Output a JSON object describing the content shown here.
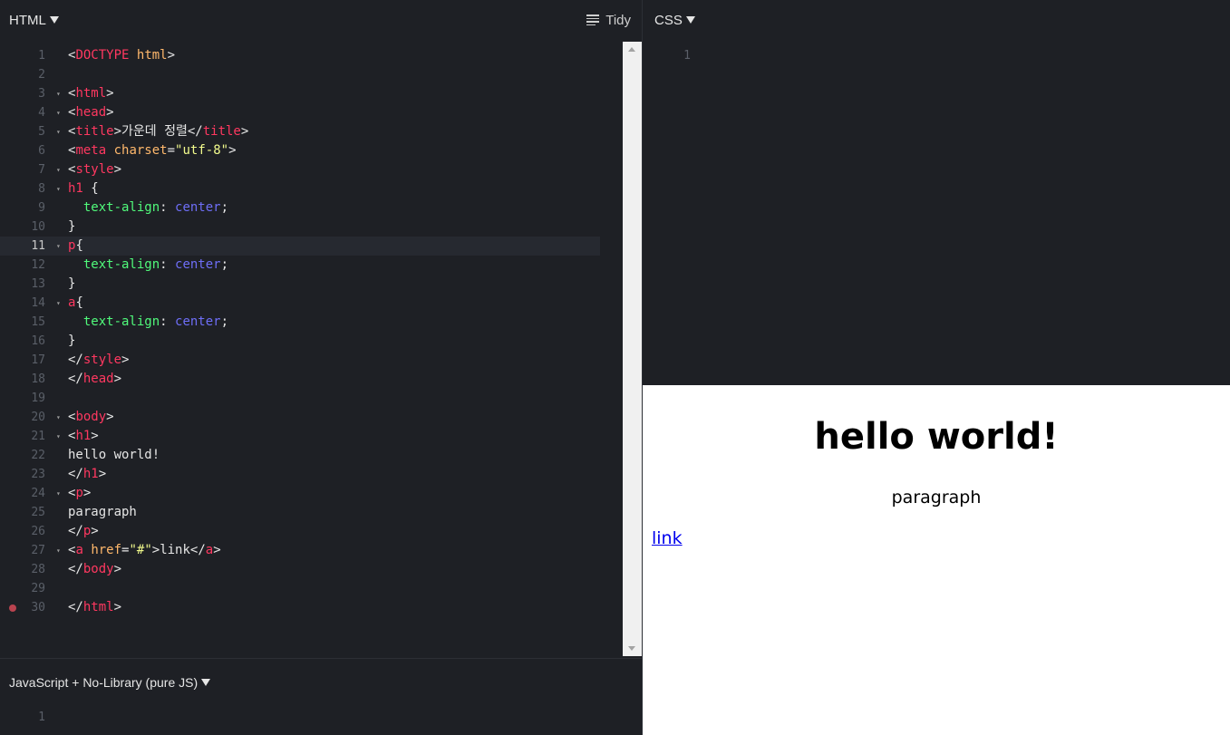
{
  "html_panel": {
    "title": "HTML",
    "tidy_label": "Tidy",
    "lines": [
      {
        "n": "1",
        "fold": false,
        "tokens": [
          [
            "punc",
            "<"
          ],
          [
            "tag",
            "DOCTYPE"
          ],
          [
            "punc",
            " "
          ],
          [
            "attr",
            "html"
          ],
          [
            "punc",
            ">"
          ]
        ]
      },
      {
        "n": "2",
        "fold": false,
        "tokens": []
      },
      {
        "n": "3",
        "fold": true,
        "tokens": [
          [
            "punc",
            "<"
          ],
          [
            "tag",
            "html"
          ],
          [
            "punc",
            ">"
          ]
        ]
      },
      {
        "n": "4",
        "fold": true,
        "tokens": [
          [
            "punc",
            "<"
          ],
          [
            "tag",
            "head"
          ],
          [
            "punc",
            ">"
          ]
        ]
      },
      {
        "n": "5",
        "fold": true,
        "tokens": [
          [
            "punc",
            "<"
          ],
          [
            "tag",
            "title"
          ],
          [
            "punc",
            ">가운데 정렬</"
          ],
          [
            "tag",
            "title"
          ],
          [
            "punc",
            ">"
          ]
        ]
      },
      {
        "n": "6",
        "fold": false,
        "tokens": [
          [
            "punc",
            "<"
          ],
          [
            "tag",
            "meta"
          ],
          [
            "punc",
            " "
          ],
          [
            "attr",
            "charset"
          ],
          [
            "punc",
            "="
          ],
          [
            "str",
            "\"utf-8\""
          ],
          [
            "punc",
            ">"
          ]
        ]
      },
      {
        "n": "7",
        "fold": true,
        "tokens": [
          [
            "punc",
            "<"
          ],
          [
            "tag",
            "style"
          ],
          [
            "punc",
            ">"
          ]
        ]
      },
      {
        "n": "8",
        "fold": true,
        "tokens": [
          [
            "tag",
            "h1"
          ],
          [
            "punc",
            " {"
          ]
        ]
      },
      {
        "n": "9",
        "fold": false,
        "tokens": [
          [
            "punc",
            "  "
          ],
          [
            "prop",
            "text-align"
          ],
          [
            "punc",
            ": "
          ],
          [
            "val",
            "center"
          ],
          [
            "punc",
            ";"
          ]
        ]
      },
      {
        "n": "10",
        "fold": false,
        "tokens": [
          [
            "punc",
            "}"
          ]
        ]
      },
      {
        "n": "11",
        "fold": true,
        "active": true,
        "tokens": [
          [
            "tag",
            "p"
          ],
          [
            "punc",
            "{"
          ]
        ]
      },
      {
        "n": "12",
        "fold": false,
        "tokens": [
          [
            "punc",
            "  "
          ],
          [
            "prop",
            "text-align"
          ],
          [
            "punc",
            ": "
          ],
          [
            "val",
            "center"
          ],
          [
            "punc",
            ";"
          ]
        ]
      },
      {
        "n": "13",
        "fold": false,
        "tokens": [
          [
            "punc",
            "}"
          ]
        ]
      },
      {
        "n": "14",
        "fold": true,
        "tokens": [
          [
            "tag",
            "a"
          ],
          [
            "punc",
            "{"
          ]
        ]
      },
      {
        "n": "15",
        "fold": false,
        "tokens": [
          [
            "punc",
            "  "
          ],
          [
            "prop",
            "text-align"
          ],
          [
            "punc",
            ": "
          ],
          [
            "val",
            "center"
          ],
          [
            "punc",
            ";"
          ]
        ]
      },
      {
        "n": "16",
        "fold": false,
        "tokens": [
          [
            "punc",
            "}"
          ]
        ]
      },
      {
        "n": "17",
        "fold": false,
        "tokens": [
          [
            "punc",
            "</"
          ],
          [
            "tag",
            "style"
          ],
          [
            "punc",
            ">"
          ]
        ]
      },
      {
        "n": "18",
        "fold": false,
        "tokens": [
          [
            "punc",
            "</"
          ],
          [
            "tag",
            "head"
          ],
          [
            "punc",
            ">"
          ]
        ]
      },
      {
        "n": "19",
        "fold": false,
        "tokens": []
      },
      {
        "n": "20",
        "fold": true,
        "tokens": [
          [
            "punc",
            "<"
          ],
          [
            "tag",
            "body"
          ],
          [
            "punc",
            ">"
          ]
        ]
      },
      {
        "n": "21",
        "fold": true,
        "tokens": [
          [
            "punc",
            "<"
          ],
          [
            "tag",
            "h1"
          ],
          [
            "punc",
            ">"
          ]
        ]
      },
      {
        "n": "22",
        "fold": false,
        "tokens": [
          [
            "punc",
            "hello world!"
          ]
        ]
      },
      {
        "n": "23",
        "fold": false,
        "tokens": [
          [
            "punc",
            "</"
          ],
          [
            "tag",
            "h1"
          ],
          [
            "punc",
            ">"
          ]
        ]
      },
      {
        "n": "24",
        "fold": true,
        "tokens": [
          [
            "punc",
            "<"
          ],
          [
            "tag",
            "p"
          ],
          [
            "punc",
            ">"
          ]
        ]
      },
      {
        "n": "25",
        "fold": false,
        "tokens": [
          [
            "punc",
            "paragraph"
          ]
        ]
      },
      {
        "n": "26",
        "fold": false,
        "tokens": [
          [
            "punc",
            "</"
          ],
          [
            "tag",
            "p"
          ],
          [
            "punc",
            ">"
          ]
        ]
      },
      {
        "n": "27",
        "fold": true,
        "tokens": [
          [
            "punc",
            "<"
          ],
          [
            "tag",
            "a"
          ],
          [
            "punc",
            " "
          ],
          [
            "attr",
            "href"
          ],
          [
            "punc",
            "="
          ],
          [
            "str",
            "\"#\""
          ],
          [
            "punc",
            ">link</"
          ],
          [
            "tag",
            "a"
          ],
          [
            "punc",
            ">"
          ]
        ]
      },
      {
        "n": "28",
        "fold": false,
        "tokens": [
          [
            "punc",
            "</"
          ],
          [
            "tag",
            "body"
          ],
          [
            "punc",
            ">"
          ]
        ]
      },
      {
        "n": "29",
        "fold": false,
        "tokens": []
      },
      {
        "n": "30",
        "fold": false,
        "breakpoint": true,
        "tokens": [
          [
            "punc",
            "</"
          ],
          [
            "tag",
            "html"
          ],
          [
            "punc",
            ">"
          ]
        ]
      }
    ]
  },
  "css_panel": {
    "title": "CSS",
    "line_number": "1"
  },
  "js_panel": {
    "title": "JavaScript + No-Library (pure JS)",
    "line_number": "1"
  },
  "preview": {
    "heading": "hello world!",
    "paragraph": "paragraph",
    "link": "link"
  },
  "colors": {
    "background": "#1e2025",
    "tag": "#ff3860",
    "attr": "#ffb86c",
    "string": "#f1fa8c",
    "property": "#50fa7b",
    "value": "#6e6ef7"
  }
}
